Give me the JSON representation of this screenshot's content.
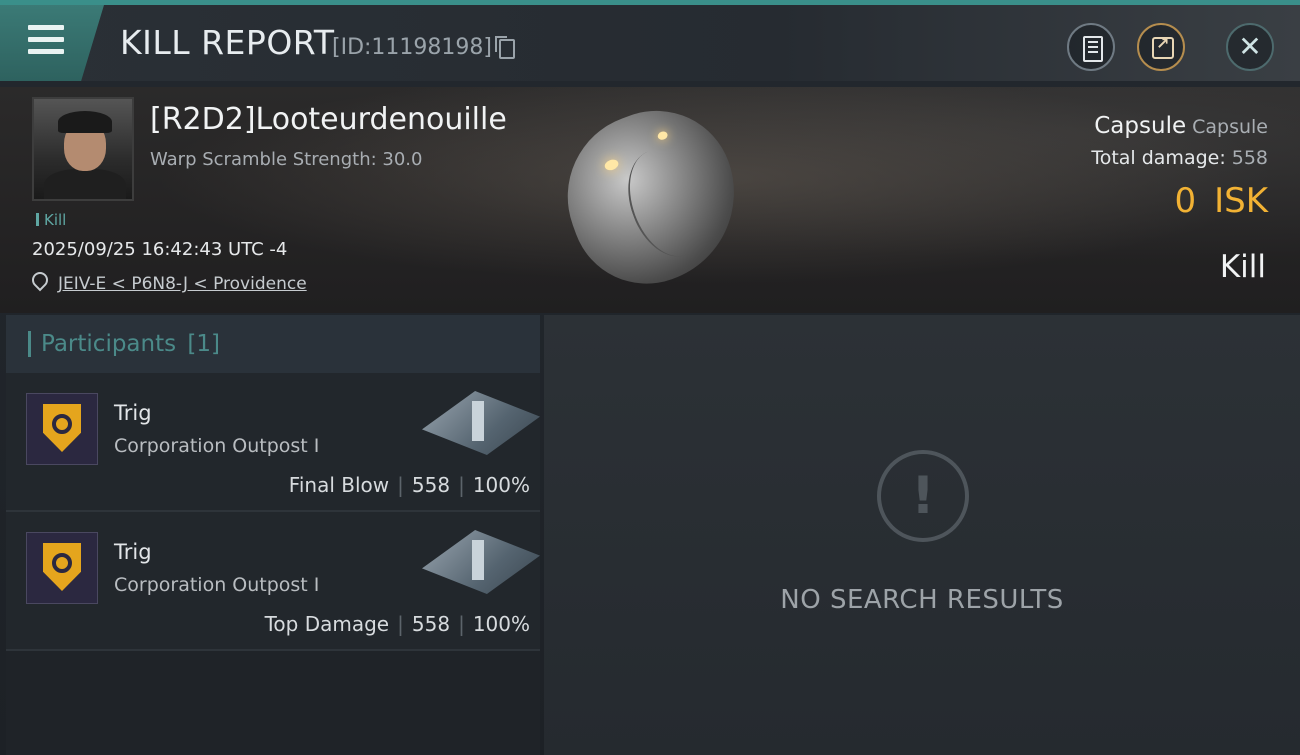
{
  "header": {
    "title": "KILL REPORT",
    "report_id": "[ID:11198198]"
  },
  "victim": {
    "name": "[R2D2]Looteurdenouille",
    "warp_scramble": "Warp Scramble Strength: 30.0",
    "tag": "Kill",
    "timestamp": "2025/09/25 16:42:43 UTC -4",
    "location": "JEIV-E < P6N8-J < Providence"
  },
  "summary": {
    "ship_name": "Capsule",
    "ship_class": "Capsule",
    "total_damage_label": "Total damage:",
    "total_damage": "558",
    "isk_value": "0",
    "isk_unit": "ISK",
    "result": "Kill"
  },
  "participants": {
    "label": "Participants",
    "count": "[1]",
    "rows": [
      {
        "name": "Trig",
        "ship": "Corporation Outpost I",
        "role": "Final Blow",
        "damage": "558",
        "percent": "100%"
      },
      {
        "name": "Trig",
        "ship": "Corporation Outpost I",
        "role": "Top Damage",
        "damage": "558",
        "percent": "100%"
      }
    ]
  },
  "empty_state": {
    "text": "NO SEARCH RESULTS"
  },
  "icons": {
    "menu": "menu-icon",
    "copy": "copy-icon",
    "report": "document-icon",
    "share": "share-icon",
    "close": "close-icon",
    "pin": "location-pin-icon",
    "warning": "exclamation-icon"
  },
  "colors": {
    "accent": "#3a8f8a",
    "isk": "#f2b234",
    "participant_header": "#4b8a89"
  }
}
